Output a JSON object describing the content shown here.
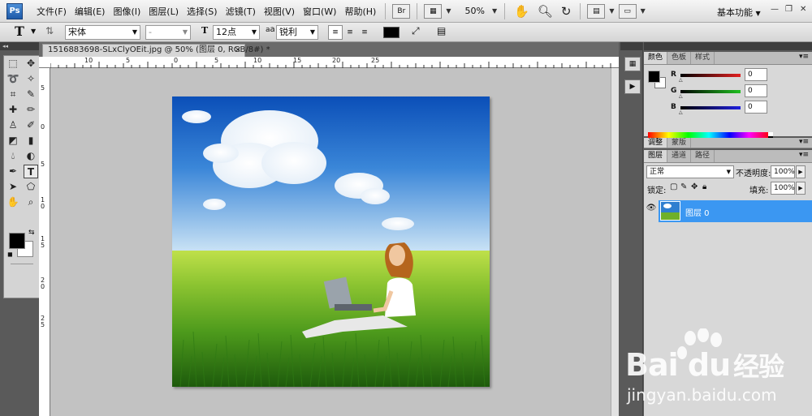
{
  "app": {
    "logo_text": "Ps",
    "menu": [
      "文件(F)",
      "编辑(E)",
      "图像(I)",
      "图层(L)",
      "选择(S)",
      "滤镜(T)",
      "视图(V)",
      "窗口(W)",
      "帮助(H)"
    ],
    "bridge_label": "Br",
    "zoom": "50%",
    "workspace": "基本功能",
    "icons": {
      "hand": "hand-icon",
      "zoom": "zoom-icon",
      "rotate": "rotate-view-icon",
      "arrange": "arrange-documents-icon",
      "screen": "screen-mode-icon"
    }
  },
  "options": {
    "tool_glyph": "T",
    "font_family": "宋体",
    "font_style": "-",
    "size_prefix": "T",
    "font_size": "12点",
    "aa_label": "a",
    "aa_prefix": "a",
    "anti_alias": "锐利",
    "color": "#000000"
  },
  "document": {
    "tab_title": "1516883698-SLxClyOEit.jpg @ 50% (图层 0, RGB/8#) *",
    "close": "×",
    "ruler_h": [
      "10",
      "5",
      "0",
      "5",
      "10",
      "15",
      "20",
      "25"
    ],
    "ruler_v": [
      "5",
      "0",
      "5",
      "1",
      "0",
      "1",
      "5",
      "2",
      "0",
      "2",
      "5"
    ]
  },
  "color_panel": {
    "tabs": [
      "颜色",
      "色板",
      "样式"
    ],
    "channels": [
      {
        "label": "R",
        "value": "0",
        "color": "#e22020"
      },
      {
        "label": "G",
        "value": "0",
        "color": "#20c020"
      },
      {
        "label": "B",
        "value": "0",
        "color": "#2020e0"
      }
    ]
  },
  "adjust_panel": {
    "tabs": [
      "调整",
      "蒙版"
    ]
  },
  "layers_panel": {
    "tabs": [
      "图层",
      "通道",
      "路径"
    ],
    "blend_mode": "正常",
    "opacity_label": "不透明度:",
    "opacity": "100%",
    "lock_label": "锁定:",
    "fill_label": "填充:",
    "fill": "100%",
    "layer_name": "图层 0"
  },
  "watermark": {
    "brand": "Bai du",
    "brand_cn": "经验",
    "url": "jingyan.baidu.com"
  }
}
